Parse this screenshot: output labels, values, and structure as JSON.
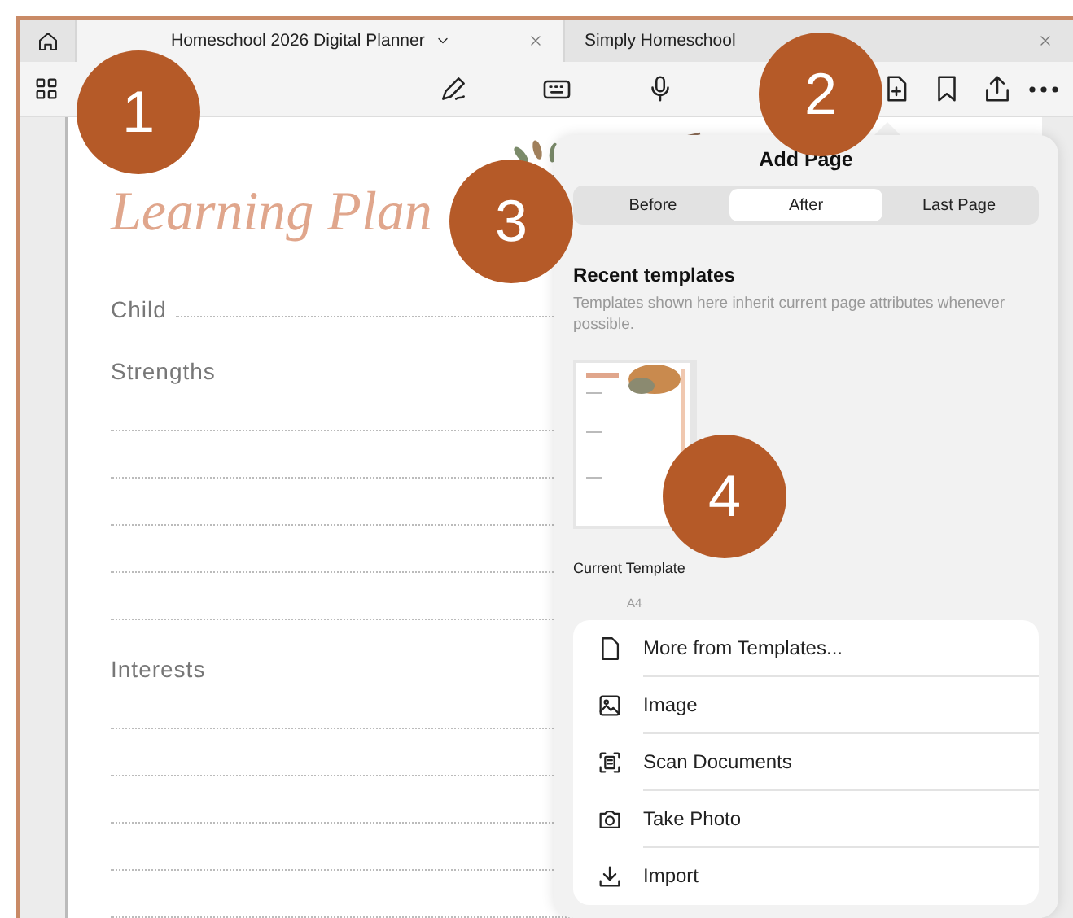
{
  "tabs": [
    {
      "label": "Homeschool 2026 Digital Planner",
      "selected": true
    },
    {
      "label": "Simply Homeschool",
      "selected": false
    }
  ],
  "document": {
    "title": "Learning Plan",
    "fields": [
      {
        "label": "Child",
        "kind": "inline"
      },
      {
        "label": "Strengths",
        "kind": "lines"
      },
      {
        "label": "Interests",
        "kind": "lines"
      }
    ]
  },
  "add_page": {
    "title": "Add Page",
    "positions": [
      {
        "label": "Before",
        "selected": false
      },
      {
        "label": "After",
        "selected": true
      },
      {
        "label": "Last Page",
        "selected": false
      }
    ],
    "section_title": "Recent templates",
    "hint": "Templates shown here inherit current page attributes whenever possible.",
    "templates": [
      {
        "name": "Current Template",
        "size": "A4"
      }
    ],
    "actions": [
      {
        "label": "More from Templates...",
        "kind": "file"
      },
      {
        "label": "Image",
        "kind": "image"
      },
      {
        "label": "Scan Documents",
        "kind": "scan"
      },
      {
        "label": "Take Photo",
        "kind": "camera"
      },
      {
        "label": "Import",
        "kind": "import"
      }
    ]
  },
  "callouts": [
    {
      "number": "1"
    },
    {
      "number": "2"
    },
    {
      "number": "3"
    },
    {
      "number": "4"
    }
  ]
}
